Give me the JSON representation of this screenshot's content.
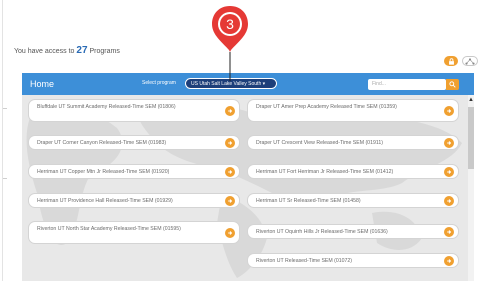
{
  "access": {
    "prefix": "You have access to",
    "count": "27",
    "suffix": "Programs"
  },
  "header": {
    "home": "Home",
    "select_label": "Select program",
    "select_value": "US Utah Salt Lake Valley South ▾",
    "find_placeholder": "Find..."
  },
  "marker": {
    "number": "3"
  },
  "cards": [
    {
      "label": "Bluffdale UT Summit Academy Released-Time SEM (01806)"
    },
    {
      "label": "Draper UT Amer Prep Academy Released Time SEM (01359)"
    },
    {
      "label": "Draper UT Corner Canyon Released-Time SEM (01983)"
    },
    {
      "label": "Draper UT Crescent View Released-Time SEM (01911)"
    },
    {
      "label": "Herriman UT Copper Mtn Jr Released-Time SEM (01920)"
    },
    {
      "label": "Herriman UT Fort Herriman Jr Released-Time SEM (01412)"
    },
    {
      "label": "Herriman UT Providence Hall Released-Time SEM (01929)"
    },
    {
      "label": "Herriman UT Sr Released-Time SEM (01458)"
    },
    {
      "label": "Riverton UT North Star Academy Released-Time SEM (01595)"
    },
    {
      "label": "Riverton UT Oquirrh Hills Jr Released-Time SEM (01636)"
    },
    {
      "label": "Riverton UT Released-Time SEM (01072)"
    }
  ],
  "colors": {
    "header": "#3d8fd8",
    "accent": "#f0a030",
    "marker": "#e53935"
  }
}
